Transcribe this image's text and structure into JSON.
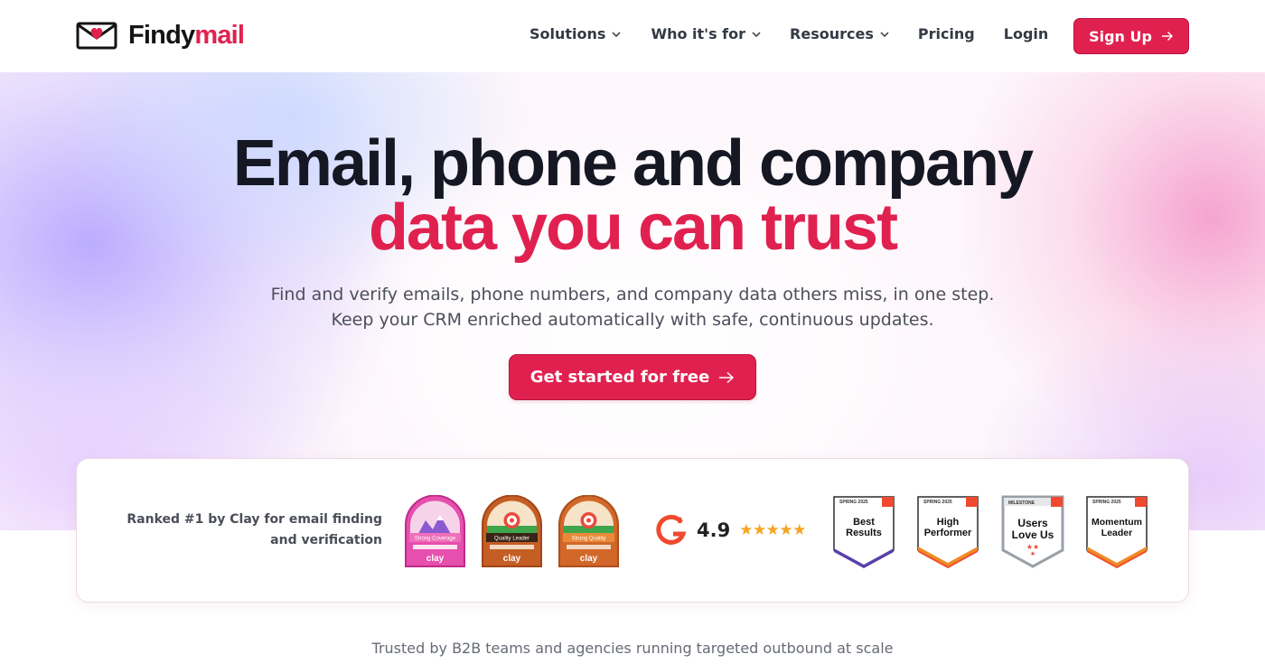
{
  "brand": {
    "name_part1": "Findy",
    "name_part2": "mail",
    "accent_color": "#e0214f"
  },
  "nav": {
    "items": [
      {
        "label": "Solutions",
        "has_dropdown": true
      },
      {
        "label": "Who it's for",
        "has_dropdown": true
      },
      {
        "label": "Resources",
        "has_dropdown": true
      },
      {
        "label": "Pricing",
        "has_dropdown": false
      },
      {
        "label": "Login",
        "has_dropdown": false
      }
    ],
    "signup_label": "Sign Up",
    "signup_icon": "arrow-right-icon"
  },
  "hero": {
    "headline_line1": "Email, phone and company",
    "headline_line2": "data you can trust",
    "sub_line1": "Find and verify emails, phone numbers, and company data others miss, in one step.",
    "sub_line2": "Keep your CRM enriched automatically with safe, continuous updates.",
    "cta_label": "Get started for free",
    "cta_icon": "arrow-right-icon"
  },
  "awards": {
    "rank_line1": "Ranked #1 by Clay for email finding",
    "rank_line2": "and verification",
    "clay_badges": [
      {
        "label": "Strong Coverage",
        "brand": "clay",
        "color": "#d6339a"
      },
      {
        "label": "Quality Leader",
        "brand": "clay",
        "color": "#c25a1f"
      },
      {
        "label": "Strong Quality",
        "brand": "clay",
        "color": "#d0601f"
      }
    ],
    "g2": {
      "rating": "4.9",
      "stars": "★★★★★",
      "logo_color": "#ef4a2f"
    },
    "g2_badges": [
      {
        "top": "SPRING 2025",
        "line1": "Best",
        "line2": "Results",
        "stripe": "#5b3fa8"
      },
      {
        "top": "SPRING 2025",
        "line1": "High",
        "line2": "Performer",
        "stripe": "#f08a24"
      },
      {
        "top": "MILESTONE",
        "line1": "Users",
        "line2": "Love Us",
        "stripe": "#9aa0a8"
      },
      {
        "top": "SPRING 2025",
        "line1": "Momentum",
        "line2": "Leader",
        "stripe": "#f08a24"
      }
    ]
  },
  "trusted_text": "Trusted by B2B teams and agencies running targeted outbound at scale"
}
